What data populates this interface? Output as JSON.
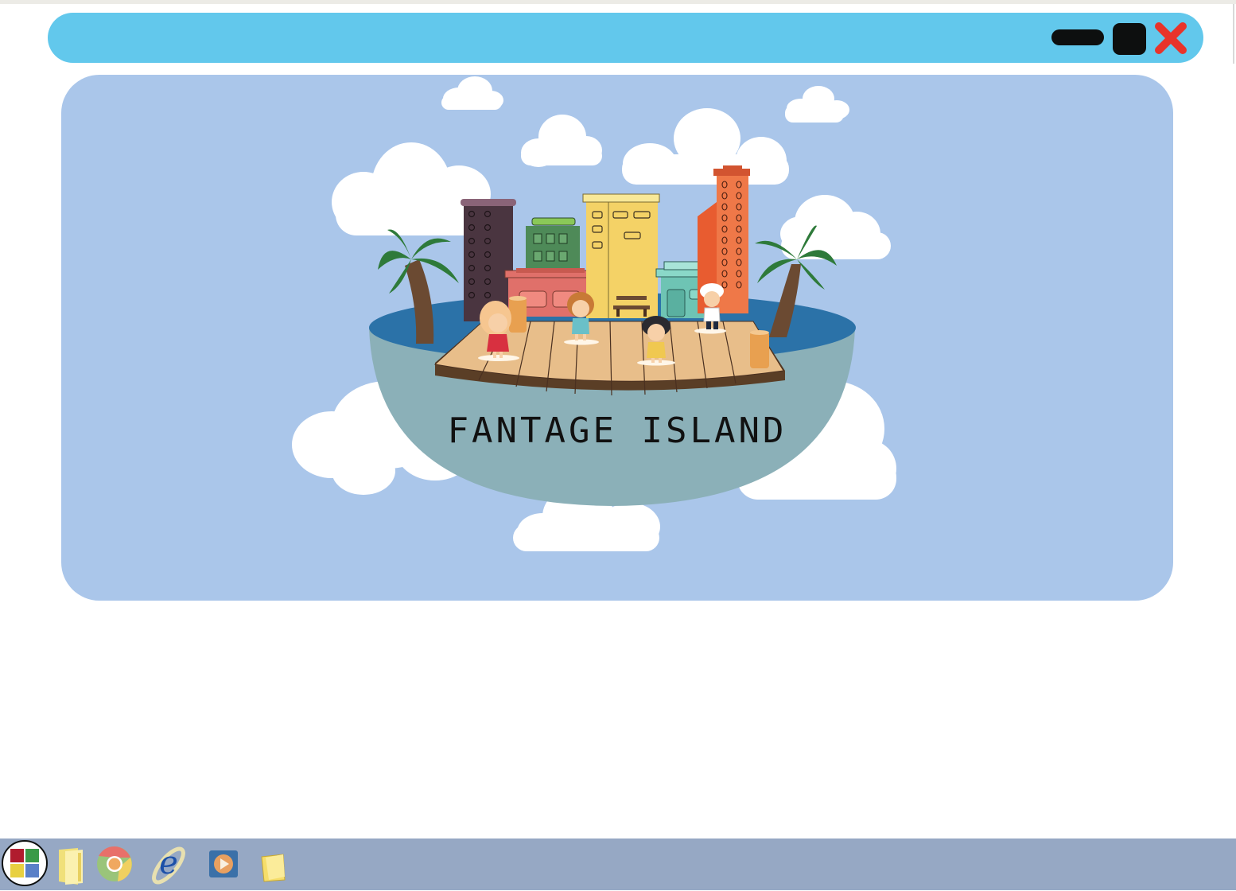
{
  "window": {
    "controls": {
      "minimize_icon": "minimize-icon",
      "maximize_icon": "maximize-icon",
      "close_icon": "close-icon"
    }
  },
  "scene": {
    "title": "FANTAGE ISLAND"
  },
  "taskbar": {
    "items": [
      {
        "icon": "start-windows-icon"
      },
      {
        "icon": "folder-icon"
      },
      {
        "icon": "chrome-browser-icon"
      },
      {
        "icon": "internet-explorer-icon"
      },
      {
        "icon": "media-player-icon"
      },
      {
        "icon": "sticky-notes-icon"
      }
    ]
  },
  "colors": {
    "titlebar": "#62c8ec",
    "stage_background": "#aac6ea",
    "close_red": "#e8332a",
    "taskbar": "#96a8c4",
    "island_water": "#2b72a8",
    "island_bowl": "#8bb0b8",
    "deck_wood": "#e8be8a"
  }
}
